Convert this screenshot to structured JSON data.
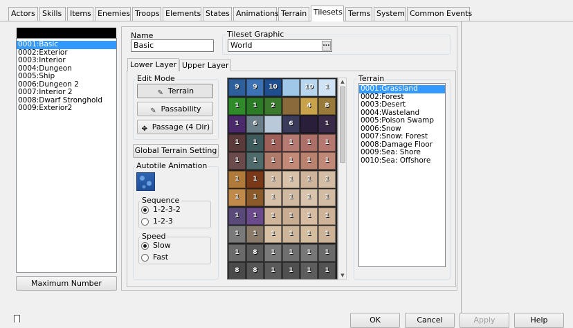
{
  "tabs": [
    "Actors",
    "Skills",
    "Items",
    "Enemies",
    "Troops",
    "Elements",
    "States",
    "Animations",
    "Terrain",
    "Tilesets",
    "Terms",
    "System",
    "Common Events"
  ],
  "active_tab": "Tilesets",
  "tileset_list": {
    "items": [
      "0001:Basic",
      "0002:Exterior",
      "0003:Interior",
      "0004:Dungeon",
      "0005:Ship",
      "0006:Dungeon 2",
      "0007:Interior 2",
      "0008:Dwarf Stronghold",
      "0009:Exterior2"
    ],
    "selected_index": 0,
    "max_button": "Maximum Number"
  },
  "name": {
    "label": "Name",
    "value": "Basic"
  },
  "graphic": {
    "label": "Tileset Graphic",
    "value": "World",
    "browse": "..."
  },
  "layer_tabs": [
    "Lower Layer",
    "Upper Layer"
  ],
  "edit_mode": {
    "label": "Edit Mode",
    "buttons": [
      "Terrain",
      "Passability",
      "Passage (4 Dir)"
    ],
    "active": "Terrain"
  },
  "global_terrain_button": "Global Terrain Setting",
  "autotile": {
    "label": "Autotile Animation",
    "sequence": {
      "label": "Sequence",
      "options": [
        "1-2-3-2",
        "1-2-3"
      ],
      "selected": "1-2-3-2"
    },
    "speed": {
      "label": "Speed",
      "options": [
        "Slow",
        "Fast"
      ],
      "selected": "Slow"
    }
  },
  "tile_grid": {
    "columns": 6,
    "cells": [
      {
        "n": "9",
        "c": "#2f5f9a"
      },
      {
        "n": "9",
        "c": "#3d72b4"
      },
      {
        "n": "10",
        "c": "#1f4e8f"
      },
      {
        "n": "",
        "c": "#9ec7e8"
      },
      {
        "n": "10",
        "c": "#b9d6ef"
      },
      {
        "n": "1",
        "c": "#cfe3f5"
      },
      {
        "n": "1",
        "c": "#2f8a2a"
      },
      {
        "n": "1",
        "c": "#2a7a26"
      },
      {
        "n": "2",
        "c": "#3b7a2c"
      },
      {
        "n": "",
        "c": "#8a6a3a"
      },
      {
        "n": "4",
        "c": "#c9a34b"
      },
      {
        "n": "8",
        "c": "#9a7a3a"
      },
      {
        "n": "1",
        "c": "#4a2a6a"
      },
      {
        "n": "6",
        "c": "#6b7f8a"
      },
      {
        "n": "",
        "c": "#b9c9d9"
      },
      {
        "n": "6",
        "c": "#3a3a5a"
      },
      {
        "n": "",
        "c": "#2a1f3a"
      },
      {
        "n": "1",
        "c": "#3a2a4a"
      },
      {
        "n": "1",
        "c": "#5a3a3a"
      },
      {
        "n": "1",
        "c": "#3f5a5a"
      },
      {
        "n": "1",
        "c": "#a0605a"
      },
      {
        "n": "1",
        "c": "#b57a72"
      },
      {
        "n": "1",
        "c": "#ad7068"
      },
      {
        "n": "1",
        "c": "#b57870"
      },
      {
        "n": "1",
        "c": "#6a4a4a"
      },
      {
        "n": "1",
        "c": "#4f6a6a"
      },
      {
        "n": "1",
        "c": "#b07a6a"
      },
      {
        "n": "1",
        "c": "#c48a78"
      },
      {
        "n": "1",
        "c": "#b8826f"
      },
      {
        "n": "1",
        "c": "#c08876"
      },
      {
        "n": "1",
        "c": "#b07a3a"
      },
      {
        "n": "1",
        "c": "#7a3a1a"
      },
      {
        "n": "1",
        "c": "#d2b9a0"
      },
      {
        "n": "1",
        "c": "#d8c2aa"
      },
      {
        "n": "1",
        "c": "#cdb49b"
      },
      {
        "n": "1",
        "c": "#d4bda5"
      },
      {
        "n": "1",
        "c": "#c08a4a"
      },
      {
        "n": "1",
        "c": "#8a5a2a"
      },
      {
        "n": "1",
        "c": "#d6c0a8"
      },
      {
        "n": "1",
        "c": "#cfb9a0"
      },
      {
        "n": "1",
        "c": "#d8c4ad"
      },
      {
        "n": "1",
        "c": "#d2bca3"
      },
      {
        "n": "1",
        "c": "#5a4a7a"
      },
      {
        "n": "1",
        "c": "#6a4a8a"
      },
      {
        "n": "1",
        "c": "#d0b49a"
      },
      {
        "n": "1",
        "c": "#c9ad92"
      },
      {
        "n": "1",
        "c": "#d6bca2"
      },
      {
        "n": "1",
        "c": "#cfb398"
      },
      {
        "n": "1",
        "c": "#7a7a7a"
      },
      {
        "n": "1",
        "c": "#8a7a6a"
      },
      {
        "n": "1",
        "c": "#d8c0a4"
      },
      {
        "n": "1",
        "c": "#cdb599"
      },
      {
        "n": "1",
        "c": "#d4bc9f"
      },
      {
        "n": "1",
        "c": "#ccb296"
      },
      {
        "n": "1",
        "c": "#6a6a6a"
      },
      {
        "n": "8",
        "c": "#5a5a5a"
      },
      {
        "n": "1",
        "c": "#7a7a7a"
      },
      {
        "n": "1",
        "c": "#6f6f6f"
      },
      {
        "n": "1",
        "c": "#777777"
      },
      {
        "n": "1",
        "c": "#6a6a6a"
      },
      {
        "n": "8",
        "c": "#4a4a4a"
      },
      {
        "n": "8",
        "c": "#555555"
      },
      {
        "n": "1",
        "c": "#5a5a5a"
      },
      {
        "n": "1",
        "c": "#505050"
      },
      {
        "n": "1",
        "c": "#5d5d5d"
      },
      {
        "n": "1",
        "c": "#525252"
      }
    ]
  },
  "terrain": {
    "label": "Terrain",
    "items": [
      "0001:Grassland",
      "0002:Forest",
      "0003:Desert",
      "0004:Wasteland",
      "0005:Poison Swamp",
      "0006:Snow",
      "0007:Snow: Forest",
      "0008:Damage Floor",
      "0009:Sea: Shore",
      "0010:Sea: Offshore"
    ],
    "selected_index": 0
  },
  "footer": {
    "ok": "OK",
    "cancel": "Cancel",
    "apply": "Apply",
    "help": "Help"
  }
}
